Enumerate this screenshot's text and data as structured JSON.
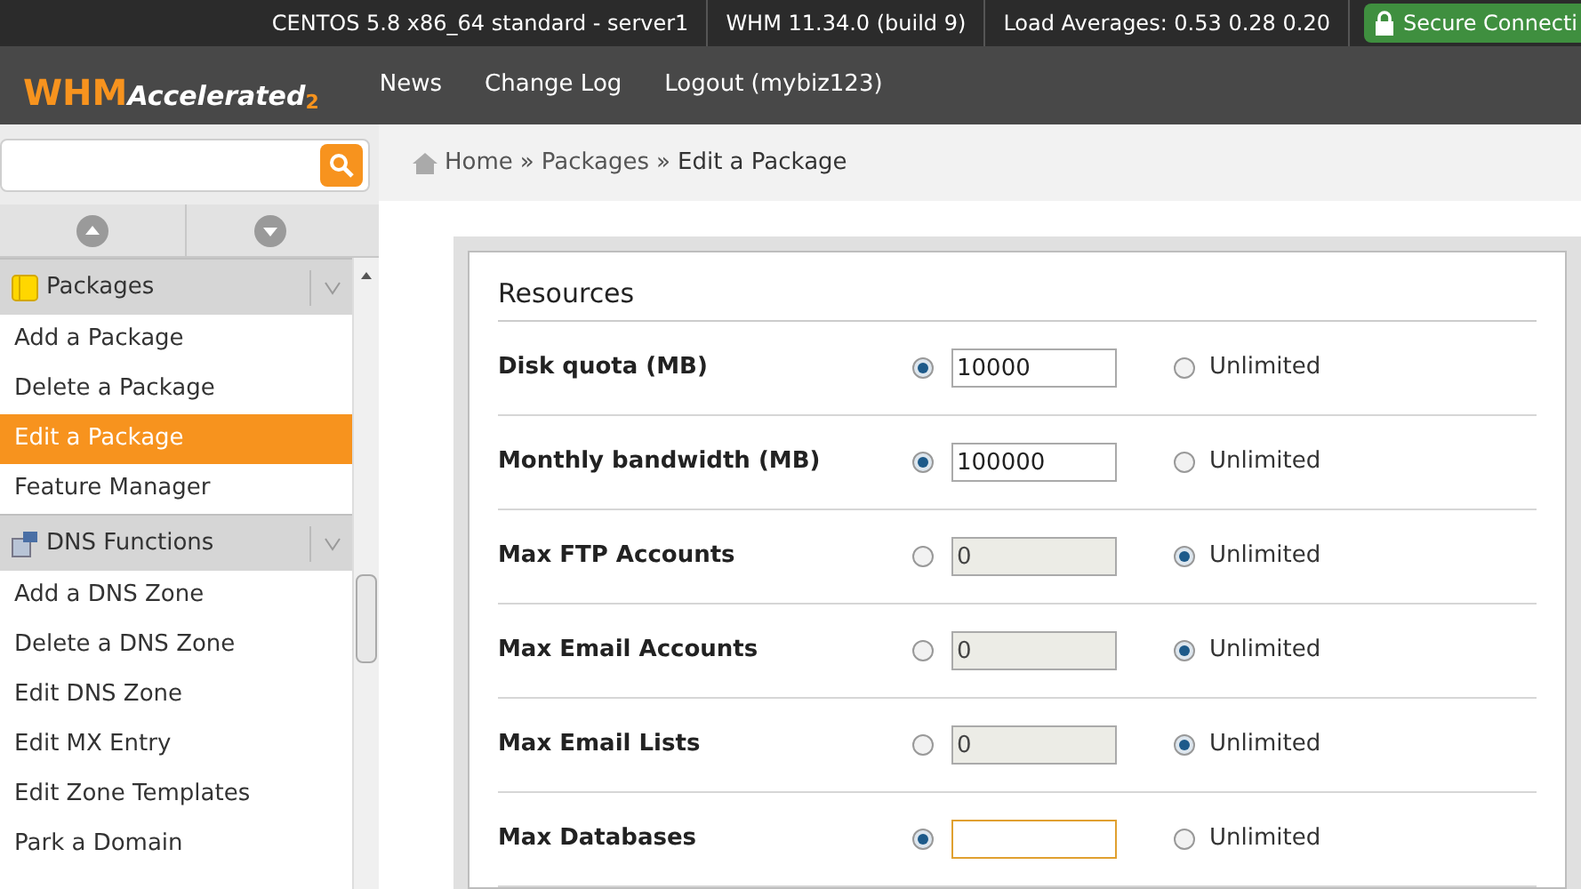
{
  "status_bar": {
    "items": [
      "CENTOS 5.8 x86_64 standard - server1",
      "WHM 11.34.0 (build 9)",
      "Load Averages: 0.53 0.28 0.20"
    ],
    "secure": "Secure Connecti"
  },
  "header": {
    "logo": "WHM",
    "logo_script": "Accelerated",
    "logo_version": "2",
    "nav": [
      "News",
      "Change Log",
      "Logout (mybiz123)"
    ]
  },
  "breadcrumb": {
    "separator": "»",
    "items": [
      "Home",
      "Packages",
      "Edit a Package"
    ]
  },
  "sidebar": {
    "sections": [
      {
        "title": "Packages",
        "items": [
          {
            "label": "Add a Package",
            "selected": false
          },
          {
            "label": "Delete a Package",
            "selected": false
          },
          {
            "label": "Edit a Package",
            "selected": true
          },
          {
            "label": "Feature Manager",
            "selected": false
          }
        ]
      },
      {
        "title": "DNS Functions",
        "items": [
          {
            "label": "Add a DNS Zone",
            "selected": false
          },
          {
            "label": "Delete a DNS Zone",
            "selected": false
          },
          {
            "label": "Edit DNS Zone",
            "selected": false
          },
          {
            "label": "Edit MX Entry",
            "selected": false
          },
          {
            "label": "Edit Zone Templates",
            "selected": false
          },
          {
            "label": "Park a Domain",
            "selected": false
          }
        ]
      }
    ]
  },
  "resources": {
    "title": "Resources",
    "rows": [
      {
        "label": "Disk quota (MB)",
        "value": "10000",
        "unlimited": false,
        "focused": false,
        "unlimited_label": "Unlimited"
      },
      {
        "label": "Monthly bandwidth (MB)",
        "value": "100000",
        "unlimited": false,
        "focused": false,
        "unlimited_label": "Unlimited"
      },
      {
        "label": "Max FTP Accounts",
        "value": "0",
        "unlimited": true,
        "focused": false,
        "unlimited_label": "Unlimited"
      },
      {
        "label": "Max Email Accounts",
        "value": "0",
        "unlimited": true,
        "focused": false,
        "unlimited_label": "Unlimited"
      },
      {
        "label": "Max Email Lists",
        "value": "0",
        "unlimited": true,
        "focused": false,
        "unlimited_label": "Unlimited"
      },
      {
        "label": "Max Databases",
        "unlimited": false,
        "focused": true,
        "unlimited_label": "Unlimited"
      }
    ]
  }
}
